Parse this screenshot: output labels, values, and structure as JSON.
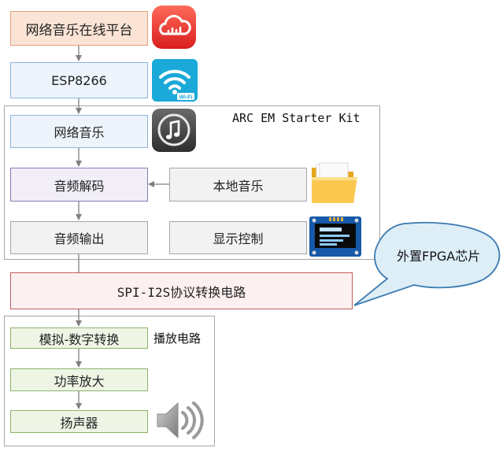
{
  "nodes": {
    "platform": "网络音乐在线平台",
    "esp": "ESP8266",
    "net_music": "网络音乐",
    "decode": "音频解码",
    "local_music": "本地音乐",
    "output": "音频输出",
    "display": "显示控制",
    "spi": "SPI-I2S协议转换电路",
    "adc": "模拟-数字转换",
    "amp": "功率放大",
    "speaker": "扬声器"
  },
  "groups": {
    "kit_label": "ARC EM Starter Kit",
    "play_label": "播放电路"
  },
  "callout": {
    "text": "外置FPGA芯片"
  },
  "icons": {
    "platform_icon": "cloud-music-icon",
    "esp_icon": "wifi-icon",
    "net_music_icon": "itunes-note-icon",
    "local_icon": "folder-icon",
    "display_icon": "oled-display-icon",
    "speaker_icon": "speaker-icon"
  },
  "colors": {
    "platform_fill": "#fbe4d5",
    "platform_border": "#e3a27c",
    "blue_fill": "#edf4fb",
    "blue_border": "#8fb4de",
    "purple_fill": "#f1eef7",
    "purple_border": "#8a7ab2",
    "gray_fill": "#f2f2f2",
    "gray_border": "#a6a6a6",
    "red_fill": "#fdf0f0",
    "red_border": "#c06060",
    "green_fill": "#eef5e5",
    "green_border": "#8cb36a",
    "callout_fill": "#ddeef7",
    "callout_border": "#3b7ab0"
  }
}
